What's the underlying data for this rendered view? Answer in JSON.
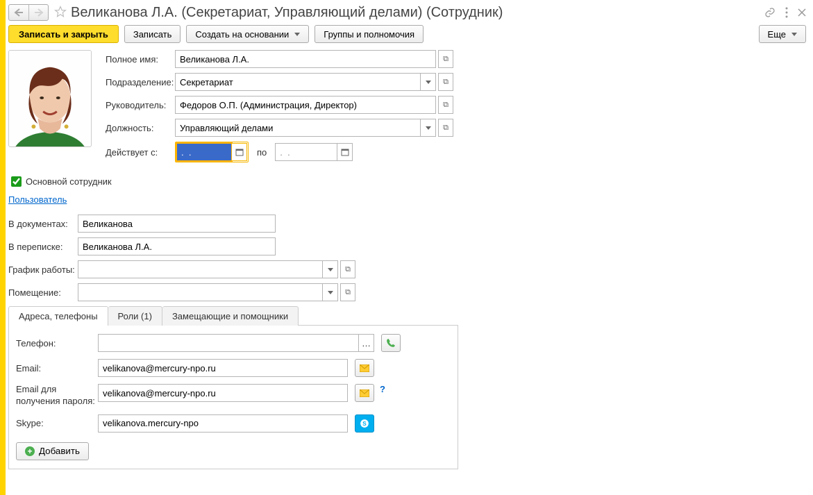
{
  "title": "Великанова Л.А. (Секретариат, Управляющий делами) (Сотрудник)",
  "toolbar": {
    "save_close": "Записать и закрыть",
    "save": "Записать",
    "create_based": "Создать на основании",
    "groups_perm": "Группы и полномочия",
    "more": "Еще"
  },
  "main": {
    "full_name_label": "Полное имя:",
    "full_name": "Великанова Л.А.",
    "dept_label": "Подразделение:",
    "dept": "Секретариат",
    "chief_label": "Руководитель:",
    "chief": "Федоров О.П. (Администрация, Директор)",
    "position_label": "Должность:",
    "position": "Управляющий делами",
    "active_from_label": "Действует с:",
    "active_from": ".  .",
    "to_label": "по",
    "active_to": ".  .    "
  },
  "primary_employee_label": "Основной сотрудник",
  "user_link": "Пользователь",
  "docs": {
    "in_docs_label": "В документах:",
    "in_docs": "Великанова",
    "in_corr_label": "В переписке:",
    "in_corr": "Великанова Л.А.",
    "schedule_label": "График работы:",
    "schedule": "",
    "room_label": "Помещение:",
    "room": ""
  },
  "tabs": {
    "t1": "Адреса, телефоны",
    "t2": "Роли (1)",
    "t3": "Замещающие и помощники"
  },
  "contacts": {
    "phone_label": "Телефон:",
    "phone": "",
    "email_label": "Email:",
    "email": "velikanova@mercury-npo.ru",
    "email_pwd_label": "Email для получения пароля:",
    "email_pwd": "velikanova@mercury-npo.ru",
    "skype_label": "Skype:",
    "skype": "velikanova.mercury-npo",
    "add": "Добавить"
  }
}
